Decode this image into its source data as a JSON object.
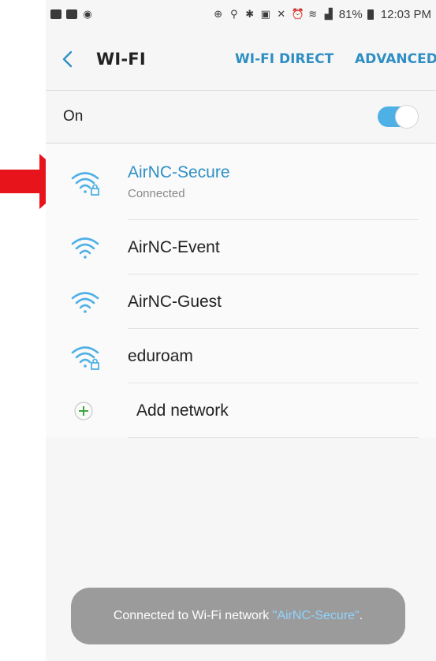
{
  "status_bar": {
    "battery": "81%",
    "time": "12:03 PM"
  },
  "app_bar": {
    "title": "WI-FI",
    "wifi_direct": "WI-FI DIRECT",
    "advanced": "ADVANCED"
  },
  "wifi_toggle": {
    "label": "On",
    "state": "on"
  },
  "networks": [
    {
      "name": "AirNC-Secure",
      "status": "Connected",
      "secured": true,
      "icon": "wifi-lock-icon"
    },
    {
      "name": "AirNC-Event",
      "secured": false,
      "icon": "wifi-icon"
    },
    {
      "name": "AirNC-Guest",
      "secured": false,
      "icon": "wifi-icon"
    },
    {
      "name": "eduroam",
      "secured": true,
      "icon": "wifi-lock-icon"
    }
  ],
  "add_network": {
    "label": "Add network",
    "icon": "plus-icon"
  },
  "toast": {
    "prefix": "Connected to Wi-Fi network ",
    "network": "\"AirNC-Secure\"",
    "suffix": "."
  },
  "colors": {
    "accent": "#2f8fc4",
    "toggle": "#4fb0e6",
    "annotation_arrow": "#e8141c",
    "add_icon": "#3ca83c"
  }
}
